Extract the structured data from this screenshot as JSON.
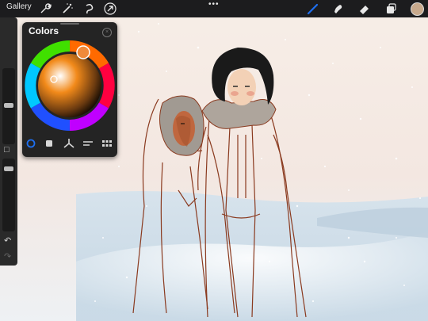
{
  "topbar": {
    "gallery_label": "Gallery",
    "more_label": "•••",
    "tools_left": [
      "wrench-icon",
      "magic-wand-icon",
      "selection-icon",
      "transform-arrow-icon"
    ],
    "tools_right": [
      "brush-icon",
      "smudge-icon",
      "eraser-icon",
      "layers-icon"
    ],
    "current_color": "#c8a98c",
    "active_tool_color": "#1e6ff0"
  },
  "sidebar": {
    "undo_label": "↶",
    "redo_label": "↷",
    "modify_label": "□"
  },
  "colors_panel": {
    "title": "Colors",
    "close_label": "×",
    "tabs": [
      "disc-tab",
      "classic-tab",
      "harmony-tab",
      "value-tab",
      "palettes-tab"
    ],
    "active_tab": "disc-tab"
  }
}
